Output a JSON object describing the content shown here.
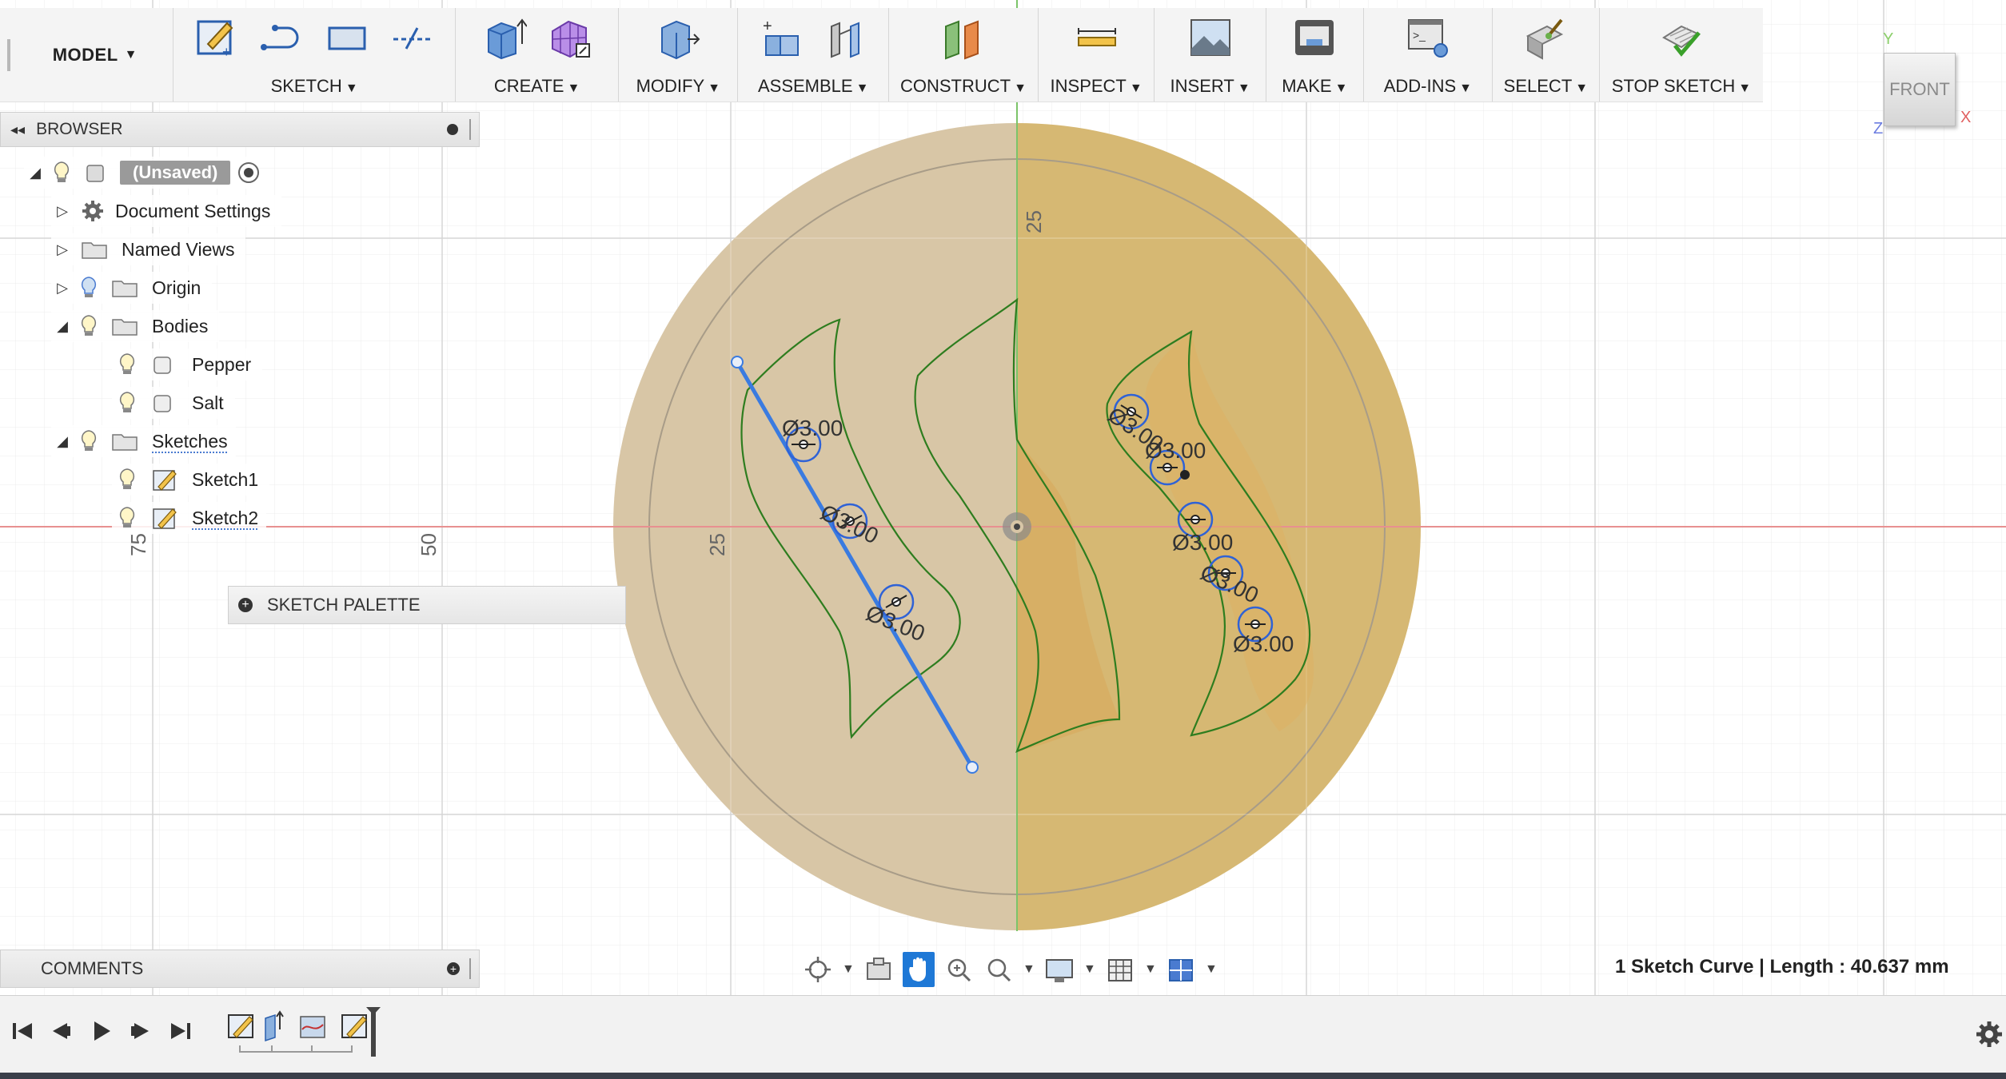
{
  "toolbar": {
    "workspace": "MODEL",
    "groups": [
      {
        "label": "SKETCH"
      },
      {
        "label": "CREATE"
      },
      {
        "label": "MODIFY"
      },
      {
        "label": "ASSEMBLE"
      },
      {
        "label": "CONSTRUCT"
      },
      {
        "label": "INSPECT"
      },
      {
        "label": "INSERT"
      },
      {
        "label": "MAKE"
      },
      {
        "label": "ADD-INS"
      },
      {
        "label": "SELECT"
      },
      {
        "label": "STOP SKETCH"
      }
    ]
  },
  "viewcube": {
    "face": "FRONT",
    "axis_y": "Y",
    "axis_x": "X",
    "axis_z": "Z"
  },
  "browser": {
    "title": "BROWSER",
    "root": "(Unsaved)",
    "items": [
      {
        "label": "Document Settings"
      },
      {
        "label": "Named Views"
      },
      {
        "label": "Origin"
      },
      {
        "label": "Bodies"
      },
      {
        "label": "Pepper"
      },
      {
        "label": "Salt"
      },
      {
        "label": "Sketches"
      },
      {
        "label": "Sketch1"
      },
      {
        "label": "Sketch2"
      }
    ]
  },
  "sketch_palette": {
    "label": "SKETCH PALETTE"
  },
  "comments": {
    "label": "COMMENTS"
  },
  "canvas": {
    "ruler_labels": [
      "25",
      "25",
      "50",
      "75"
    ],
    "dimensions": [
      "Ø3.00",
      "Ø3.00",
      "Ø3.00",
      "Ø3.00",
      "Ø3.00",
      "Ø3.00",
      "Ø3.00",
      "Ø3.00"
    ]
  },
  "status": {
    "text": "1 Sketch Curve | Length : 40.637 mm"
  },
  "colors": {
    "accent": "#1e78d6",
    "disc_left": "#d8c4a0",
    "disc_right": "#d4b26a",
    "sketch_profile": "#2e7d1f",
    "selected_line": "#3a7be0",
    "x_axis": "#e89090",
    "y_axis": "#7cc46a"
  }
}
